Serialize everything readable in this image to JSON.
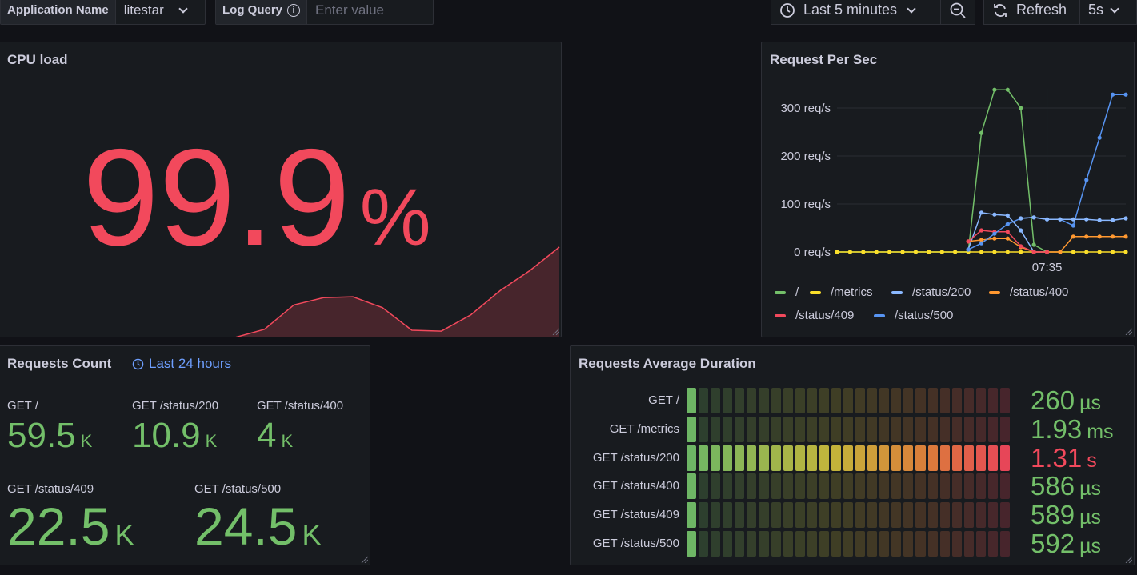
{
  "toolbar": {
    "app_label": "Application Name",
    "app_value": "litestar",
    "log_label": "Log Query",
    "log_placeholder": "Enter value",
    "time_range": "Last 5 minutes",
    "refresh_label": "Refresh",
    "refresh_interval": "5s"
  },
  "cpu": {
    "title": "CPU load",
    "value": "99.9",
    "unit": "%",
    "color": "#f2495c",
    "sparkline": [
      0,
      0,
      0,
      0,
      0,
      0,
      0,
      0,
      0,
      0.09,
      0.36,
      0.44,
      0.45,
      0.33,
      0.08,
      0.07,
      0.25,
      0.52,
      0.74,
      1.0
    ]
  },
  "rps": {
    "title": "Request Per Sec",
    "time_label": "07:35",
    "chart_data": {
      "type": "line",
      "title": "Request Per Sec",
      "xlabel": "",
      "ylabel": "",
      "ylim": [
        0,
        340
      ],
      "yticks": [
        "0 req/s",
        "100 req/s",
        "200 req/s",
        "300 req/s"
      ],
      "ytick_values": [
        0,
        100,
        200,
        300
      ],
      "x_ticks": [
        "07:35"
      ],
      "legend": "bottom",
      "grid": true,
      "series": [
        {
          "name": "/",
          "color": "#73bf69",
          "values": [
            0,
            0,
            0,
            0,
            0,
            0,
            0,
            0,
            0,
            0,
            0,
            248,
            338,
            338,
            300,
            15,
            0,
            null,
            null,
            null,
            null,
            null,
            null
          ]
        },
        {
          "name": "/metrics",
          "color": "#fade2a",
          "values": [
            0,
            0,
            0,
            0,
            0,
            0,
            0,
            0,
            0,
            0,
            0,
            0,
            0,
            0,
            0,
            0,
            0,
            0,
            0,
            0,
            0,
            0,
            0
          ]
        },
        {
          "name": "/status/200",
          "color": "#8ab8ff",
          "values": [
            null,
            null,
            null,
            null,
            null,
            null,
            null,
            null,
            null,
            null,
            5,
            82,
            78,
            76,
            45,
            0,
            0,
            null,
            null,
            null,
            null,
            null,
            null
          ]
        },
        {
          "name": "/status/400",
          "color": "#ff9830",
          "values": [
            null,
            null,
            null,
            null,
            null,
            null,
            null,
            null,
            null,
            null,
            22,
            25,
            28,
            28,
            10,
            0,
            0,
            0,
            32,
            32,
            32,
            32,
            32
          ]
        },
        {
          "name": "/status/409",
          "color": "#f2495c",
          "values": [
            null,
            null,
            null,
            null,
            null,
            null,
            null,
            null,
            null,
            null,
            22,
            45,
            42,
            42,
            12,
            0,
            0,
            null,
            null,
            null,
            null,
            null,
            null
          ]
        },
        {
          "name": "/status/500",
          "color": "#5794f2",
          "values": [
            null,
            null,
            null,
            null,
            null,
            null,
            null,
            null,
            null,
            null,
            5,
            18,
            38,
            58,
            70,
            72,
            68,
            68,
            55,
            150,
            238,
            328,
            328
          ]
        },
        {
          "name": "",
          "color": "#8ab8ff",
          "values": [
            null,
            null,
            null,
            null,
            null,
            null,
            null,
            null,
            null,
            null,
            null,
            null,
            null,
            null,
            70,
            72,
            68,
            68,
            68,
            68,
            66,
            66,
            70
          ]
        }
      ]
    }
  },
  "counts": {
    "title": "Requests Count",
    "range": "Last 24 hours",
    "items": [
      {
        "name": "GET /",
        "value": "59.5",
        "unit": "K"
      },
      {
        "name": "GET /status/200",
        "value": "10.9",
        "unit": "K"
      },
      {
        "name": "GET /status/400",
        "value": "4",
        "unit": "K"
      },
      {
        "name": "GET /status/409",
        "value": "22.5",
        "unit": "K"
      },
      {
        "name": "GET /status/500",
        "value": "24.5",
        "unit": "K"
      }
    ]
  },
  "duration": {
    "title": "Requests Average Duration",
    "rows": [
      {
        "label": "GET /",
        "value": "260",
        "unit": "µs",
        "level": 0.02,
        "color": "#73bf69"
      },
      {
        "label": "GET /metrics",
        "value": "1.93",
        "unit": "ms",
        "level": 0.02,
        "color": "#73bf69"
      },
      {
        "label": "GET /status/200",
        "value": "1.31",
        "unit": "s",
        "level": 1.0,
        "color": "#f2495c"
      },
      {
        "label": "GET /status/400",
        "value": "586",
        "unit": "µs",
        "level": 0.02,
        "color": "#73bf69"
      },
      {
        "label": "GET /status/409",
        "value": "589",
        "unit": "µs",
        "level": 0.02,
        "color": "#73bf69"
      },
      {
        "label": "GET /status/500",
        "value": "592",
        "unit": "µs",
        "level": 0.02,
        "color": "#73bf69"
      }
    ]
  }
}
